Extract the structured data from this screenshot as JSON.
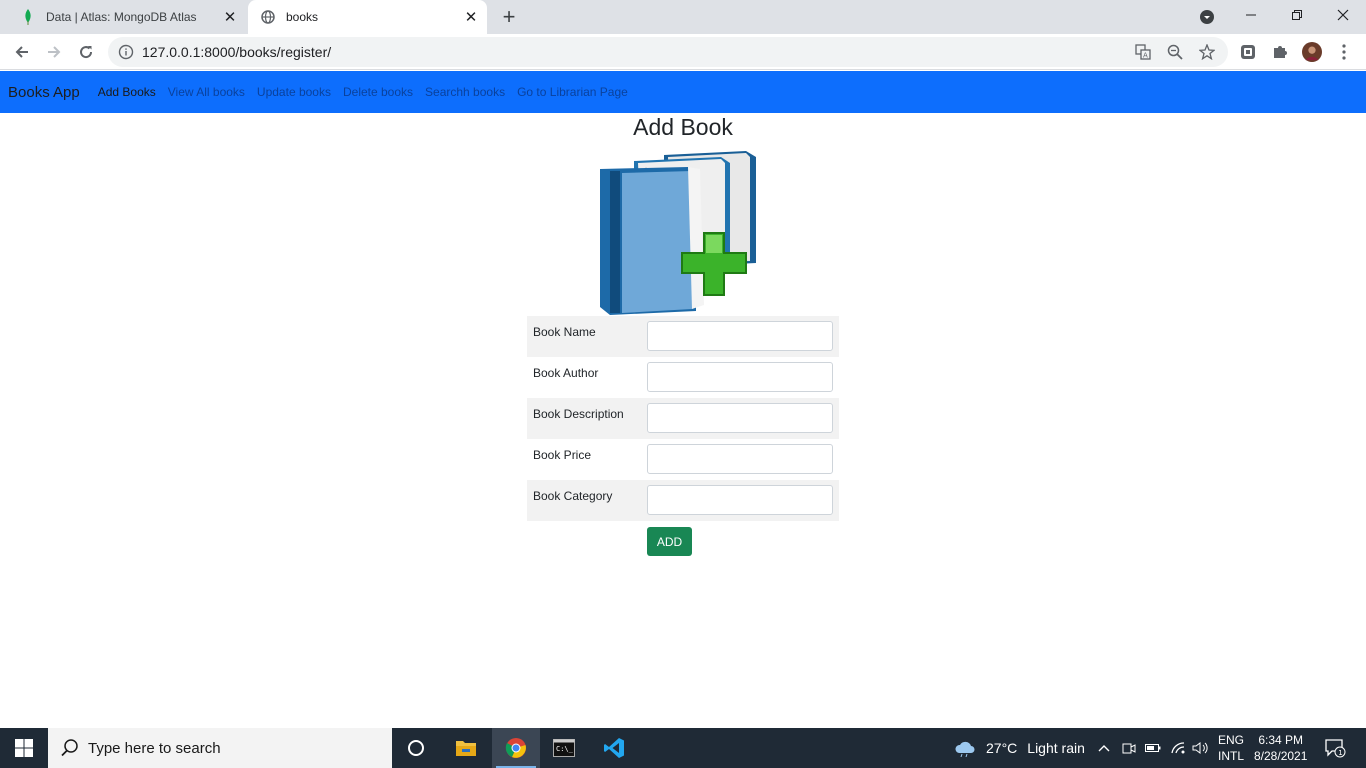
{
  "browser": {
    "tabs": [
      {
        "title": "Data | Atlas: MongoDB Atlas",
        "icon": "mongodb-leaf-icon",
        "active": false
      },
      {
        "title": "books",
        "icon": "globe-icon",
        "active": true
      }
    ],
    "new_tab": "+",
    "url": "127.0.0.1:8000/books/register/"
  },
  "navbar": {
    "brand": "Books App",
    "links": [
      {
        "label": "Add Books",
        "active": true
      },
      {
        "label": "View All books",
        "active": false
      },
      {
        "label": "Update books",
        "active": false
      },
      {
        "label": "Delete books",
        "active": false
      },
      {
        "label": "Searchh books",
        "active": false
      },
      {
        "label": "Go to Librarian Page",
        "active": false
      }
    ],
    "color": "#0d6efd"
  },
  "page": {
    "title": "Add Book",
    "image": "books-with-plus-icon",
    "form": {
      "fields": [
        {
          "label": "Book Name",
          "value": ""
        },
        {
          "label": "Book Author",
          "value": ""
        },
        {
          "label": "Book Description",
          "value": ""
        },
        {
          "label": "Book Price",
          "value": ""
        },
        {
          "label": "Book Category",
          "value": ""
        }
      ],
      "submit_label": "ADD",
      "submit_color": "#198754"
    }
  },
  "taskbar": {
    "search_placeholder": "Type here to search",
    "weather": {
      "temp": "27°C",
      "text": "Light rain"
    },
    "language": {
      "line1": "ENG",
      "line2": "INTL"
    },
    "clock": {
      "time": "6:34 PM",
      "date": "8/28/2021"
    },
    "notifications": "1"
  }
}
